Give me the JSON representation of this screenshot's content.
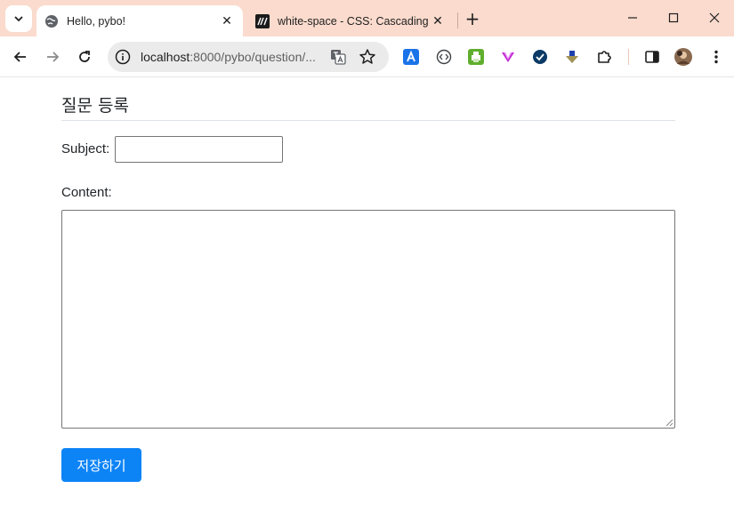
{
  "browser": {
    "tabs": [
      {
        "title": "Hello, pybo!",
        "favicon": "globe-icon",
        "active": true
      },
      {
        "title": "white-space - CSS: Cascading S",
        "favicon": "mdn-icon",
        "active": false
      }
    ],
    "close_glyph": "✕",
    "new_tab_glyph": "+",
    "address": {
      "host": "localhost",
      "rest": ":8000/pybo/question/..."
    },
    "extensions": [
      "translate-a-icon",
      "code-icon",
      "print-icon",
      "vee-icon",
      "check-circle-icon",
      "download-arrow-icon",
      "puzzle-icon",
      "sidepanel-icon",
      "profile-avatar",
      "menu-icon"
    ],
    "accent": "#fadbcd"
  },
  "page": {
    "title": "질문 등록",
    "subject": {
      "label": "Subject:",
      "value": ""
    },
    "content": {
      "label": "Content:",
      "value": ""
    },
    "submit_label": "저장하기",
    "submit_color": "#0d84f6"
  }
}
